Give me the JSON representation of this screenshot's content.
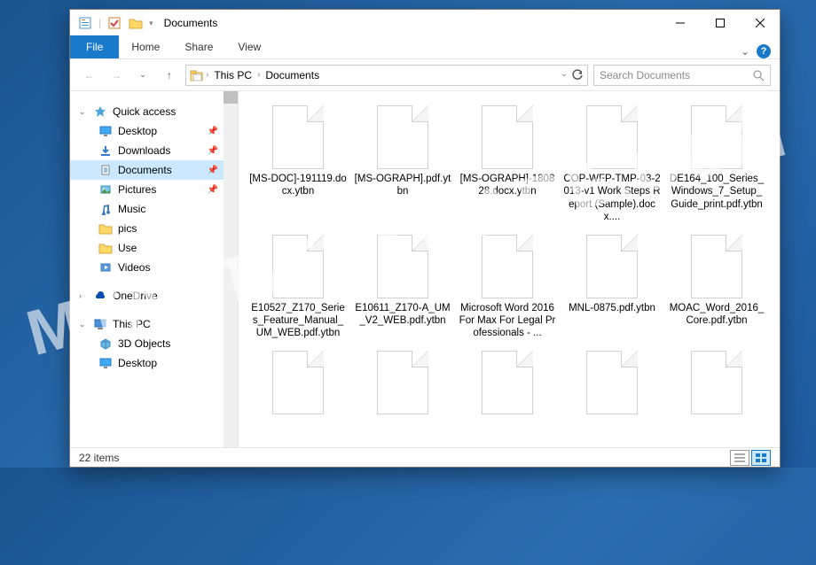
{
  "window": {
    "title": "Documents"
  },
  "ribbon": {
    "file": "File",
    "tabs": [
      "Home",
      "Share",
      "View"
    ]
  },
  "breadcrumbs": [
    "This PC",
    "Documents"
  ],
  "search": {
    "placeholder": "Search Documents"
  },
  "sidebar": {
    "quick_access": "Quick access",
    "qa_items": [
      {
        "label": "Desktop",
        "pinned": true
      },
      {
        "label": "Downloads",
        "pinned": true
      },
      {
        "label": "Documents",
        "pinned": true,
        "selected": true
      },
      {
        "label": "Pictures",
        "pinned": true
      },
      {
        "label": "Music",
        "pinned": false
      },
      {
        "label": "pics",
        "pinned": false
      },
      {
        "label": "Use",
        "pinned": false
      },
      {
        "label": "Videos",
        "pinned": false
      }
    ],
    "onedrive": "OneDrive",
    "this_pc": "This PC",
    "pc_items": [
      {
        "label": "3D Objects"
      },
      {
        "label": "Desktop"
      }
    ]
  },
  "files": [
    "[MS-DOC]-191119.docx.ytbn",
    "[MS-OGRAPH].pdf.ytbn",
    "[MS-OGRAPH]-180828.docx.ytbn",
    "COP-WFP-TMP-03-2013-v1 Work Steps Report (Sample).docx....",
    "DE164_100_Series_Windows_7_Setup_Guide_print.pdf.ytbn",
    "E10527_Z170_Series_Feature_Manual_UM_WEB.pdf.ytbn",
    "E10611_Z170-A_UM_V2_WEB.pdf.ytbn",
    "Microsoft Word 2016 For Max For Legal Professionals - ...",
    "MNL-0875.pdf.ytbn",
    "MOAC_Word_2016_Core.pdf.ytbn",
    "",
    "",
    "",
    "",
    ""
  ],
  "status": {
    "count": "22 items"
  },
  "watermark": "MYANTISPYWARE.COM",
  "colors": {
    "accent": "#1979ca",
    "selection": "#cce8ff"
  }
}
